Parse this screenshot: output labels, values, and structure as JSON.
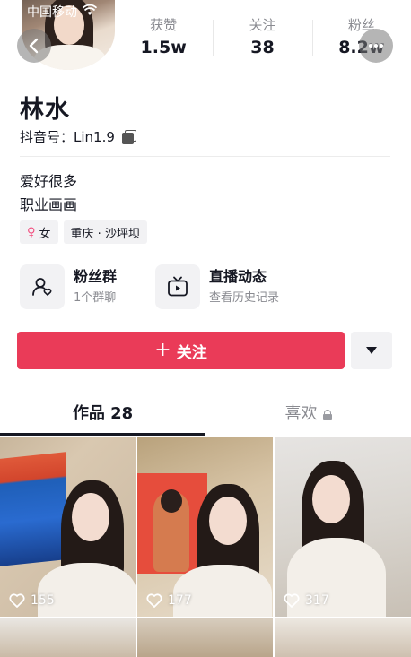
{
  "status_bar": {
    "carrier": "中国移动"
  },
  "stats": [
    {
      "label": "获赞",
      "value": "1.5w"
    },
    {
      "label": "关注",
      "value": "38"
    },
    {
      "label": "粉丝",
      "value": "8.2w"
    }
  ],
  "profile": {
    "name": "林水",
    "douyin_id": "抖音号：Lin1.9",
    "bio_lines": [
      "爱好很多",
      "职业画画"
    ],
    "tags": {
      "gender": "女",
      "location": "重庆 · 沙坪坝"
    }
  },
  "features": {
    "fans_group": {
      "title": "粉丝群",
      "subtitle": "1个群聊"
    },
    "live": {
      "title": "直播动态",
      "subtitle": "查看历史记录"
    }
  },
  "actions": {
    "follow_label": "关注"
  },
  "tabs": [
    {
      "label": "作品 28"
    },
    {
      "label": "喜欢"
    }
  ],
  "videos": [
    {
      "likes": "155"
    },
    {
      "likes": "177"
    },
    {
      "likes": "317"
    }
  ],
  "colors": {
    "follow": "#ea3b58",
    "female": "#f24a7c"
  }
}
